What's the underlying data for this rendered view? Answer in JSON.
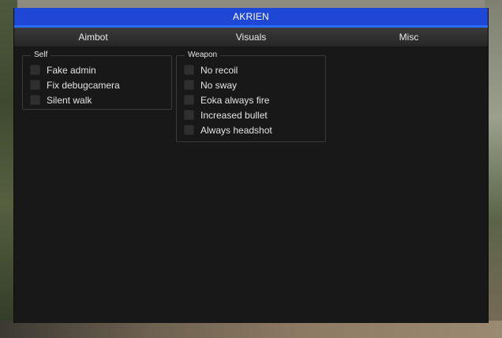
{
  "window": {
    "title": "AKRIEN"
  },
  "tabs": [
    {
      "label": "Aimbot"
    },
    {
      "label": "Visuals"
    },
    {
      "label": "Misc"
    }
  ],
  "groups": {
    "self": {
      "title": "Self",
      "items": [
        {
          "label": "Fake admin",
          "checked": false
        },
        {
          "label": "Fix debugcamera",
          "checked": false
        },
        {
          "label": "Silent walk",
          "checked": false
        }
      ]
    },
    "weapon": {
      "title": "Weapon",
      "items": [
        {
          "label": "No recoil",
          "checked": false
        },
        {
          "label": "No sway",
          "checked": false
        },
        {
          "label": "Eoka always fire",
          "checked": false
        },
        {
          "label": "Increased bullet",
          "checked": false
        },
        {
          "label": "Always headshot",
          "checked": false
        }
      ]
    }
  },
  "colors": {
    "accent": "#1f47d6",
    "accent_line": "#2c6bff",
    "panel": "#181818",
    "checkbox": "#2f2f2f"
  }
}
